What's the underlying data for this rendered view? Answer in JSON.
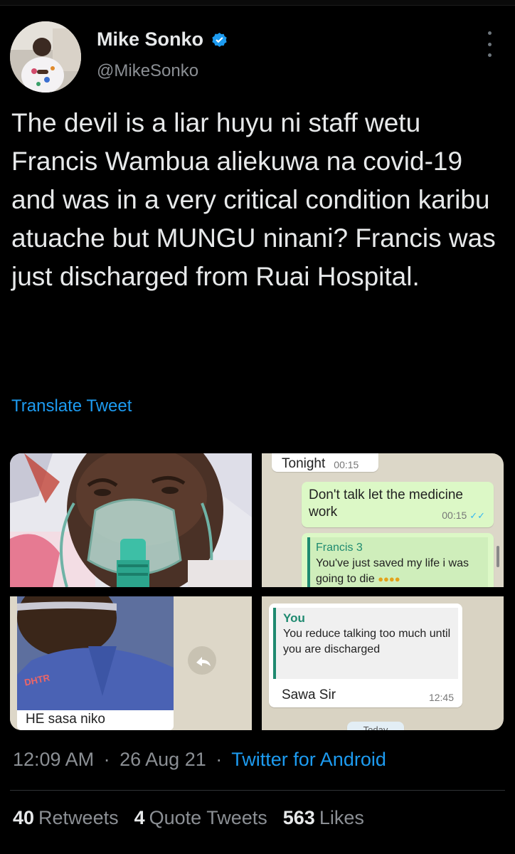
{
  "tweet": {
    "author_name": "Mike Sonko",
    "author_handle": "@MikeSonko",
    "text": "The devil is a liar huyu ni staff wetu Francis Wambua aliekuwa na covid-19 and was in a very critical condition karibu atuache but MUNGU ninani? Francis was just discharged from Ruai Hospital.",
    "translate_label": "Translate Tweet",
    "time": "12:09 AM",
    "date": "26 Aug 21",
    "separator": "·",
    "source_app": "Twitter for Android",
    "stats": [
      {
        "count": "40",
        "label": "Retweets"
      },
      {
        "count": "4",
        "label": "Quote Tweets"
      },
      {
        "count": "563",
        "label": "Likes"
      }
    ]
  },
  "media": {
    "chat1": {
      "label_tonight": "Tonight",
      "time_tonight": "00:15",
      "out_message": "Don't talk let the medicine work",
      "out_time": "00:15",
      "reply_sender": "Francis 3",
      "reply_text": "You've just saved my life i was going to die"
    },
    "photo2": {
      "caption": "HE sasa niko",
      "shirt_text": "DHTR"
    },
    "chat2": {
      "quote_sender": "You",
      "quote_text": "You reduce talking too much until you are discharged",
      "reply_text": "Sawa Sir",
      "reply_time": "12:45",
      "day_label": "Today"
    }
  },
  "colors": {
    "background": "#000000",
    "text": "#e7e9ea",
    "muted": "#8b8f94",
    "link": "#1d9bf0",
    "verified": "#1d9bf0",
    "wa_bubble_out": "#dcf8c6",
    "wa_name": "#1f8a70"
  },
  "icons": {
    "verified": "verified-badge-icon",
    "more": "more-vertical-icon",
    "forward": "forward-arrow-icon",
    "read_receipt": "double-check-icon",
    "emoji": "crying-emoji-icon"
  }
}
